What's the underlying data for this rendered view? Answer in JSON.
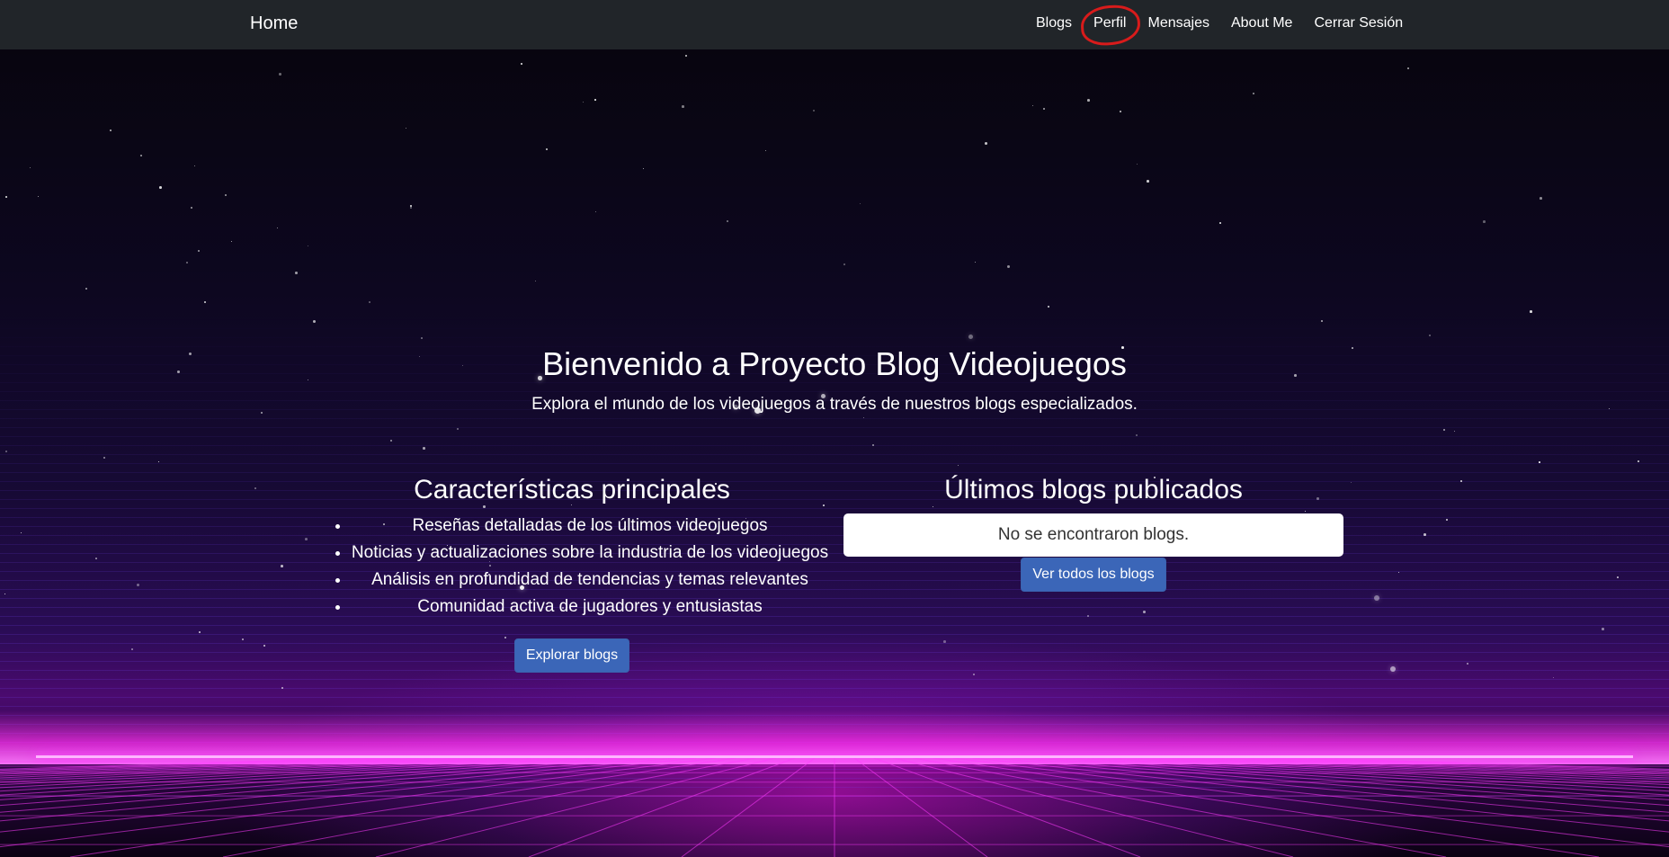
{
  "navbar": {
    "brand": "Home",
    "links": [
      {
        "label": "Blogs"
      },
      {
        "label": "Perfil",
        "highlighted": true
      },
      {
        "label": "Mensajes"
      },
      {
        "label": "About Me"
      },
      {
        "label": "Cerrar Sesión"
      }
    ]
  },
  "hero": {
    "title": "Bienvenido a Proyecto Blog Videojuegos",
    "subtitle": "Explora el mundo de los videojuegos a través de nuestros blogs especializados."
  },
  "features": {
    "heading": "Características principales",
    "items": [
      "Reseñas detalladas de los últimos videojuegos",
      "Noticias y actualizaciones sobre la industria de los videojuegos",
      "Análisis en profundidad de tendencias y temas relevantes",
      "Comunidad activa de jugadores y entusiastas"
    ],
    "button_label": "Explorar blogs"
  },
  "latest_blogs": {
    "heading": "Últimos blogs publicados",
    "empty_message": "No se encontraron blogs.",
    "button_label": "Ver todos los blogs"
  },
  "colors": {
    "navbar_bg": "#212529",
    "button_bg": "#3b66b8",
    "neon_magenta": "#ff00ff",
    "annotation_red": "#d81b1b"
  }
}
